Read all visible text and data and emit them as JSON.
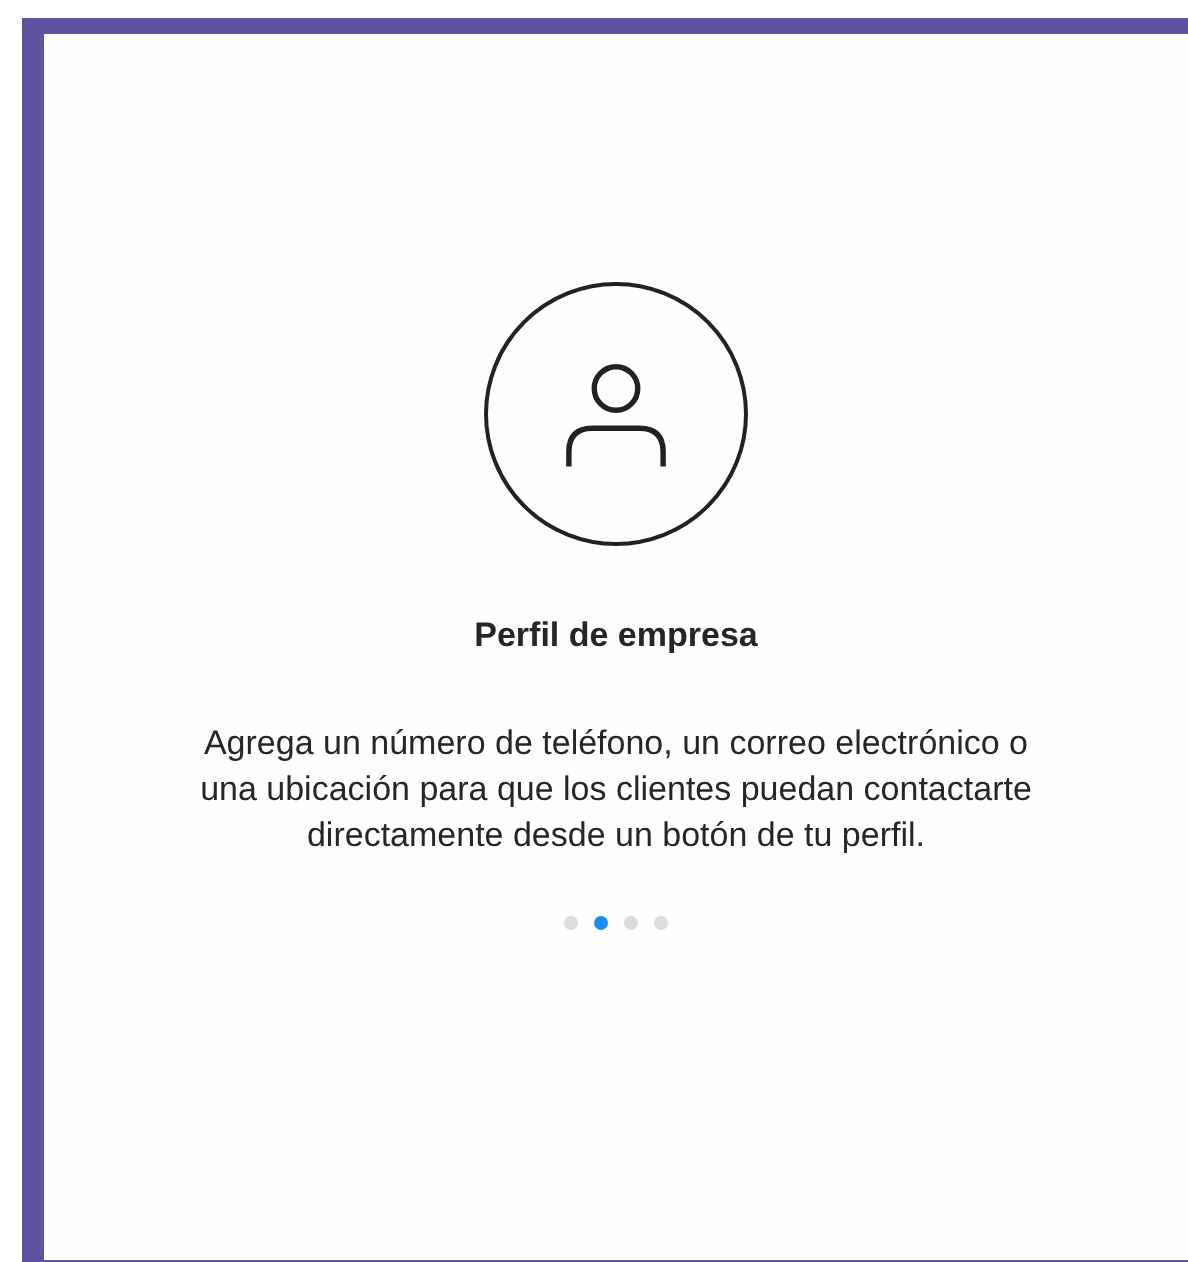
{
  "title": "Perfil de empresa",
  "description": "Agrega un número de teléfono, un correo electrónico o una ubicación para que los clientes puedan contactarte directamente desde un botón de tu perfil.",
  "page_dots": [
    {
      "selected": false
    },
    {
      "selected": true
    },
    {
      "selected": false
    },
    {
      "selected": false
    }
  ]
}
